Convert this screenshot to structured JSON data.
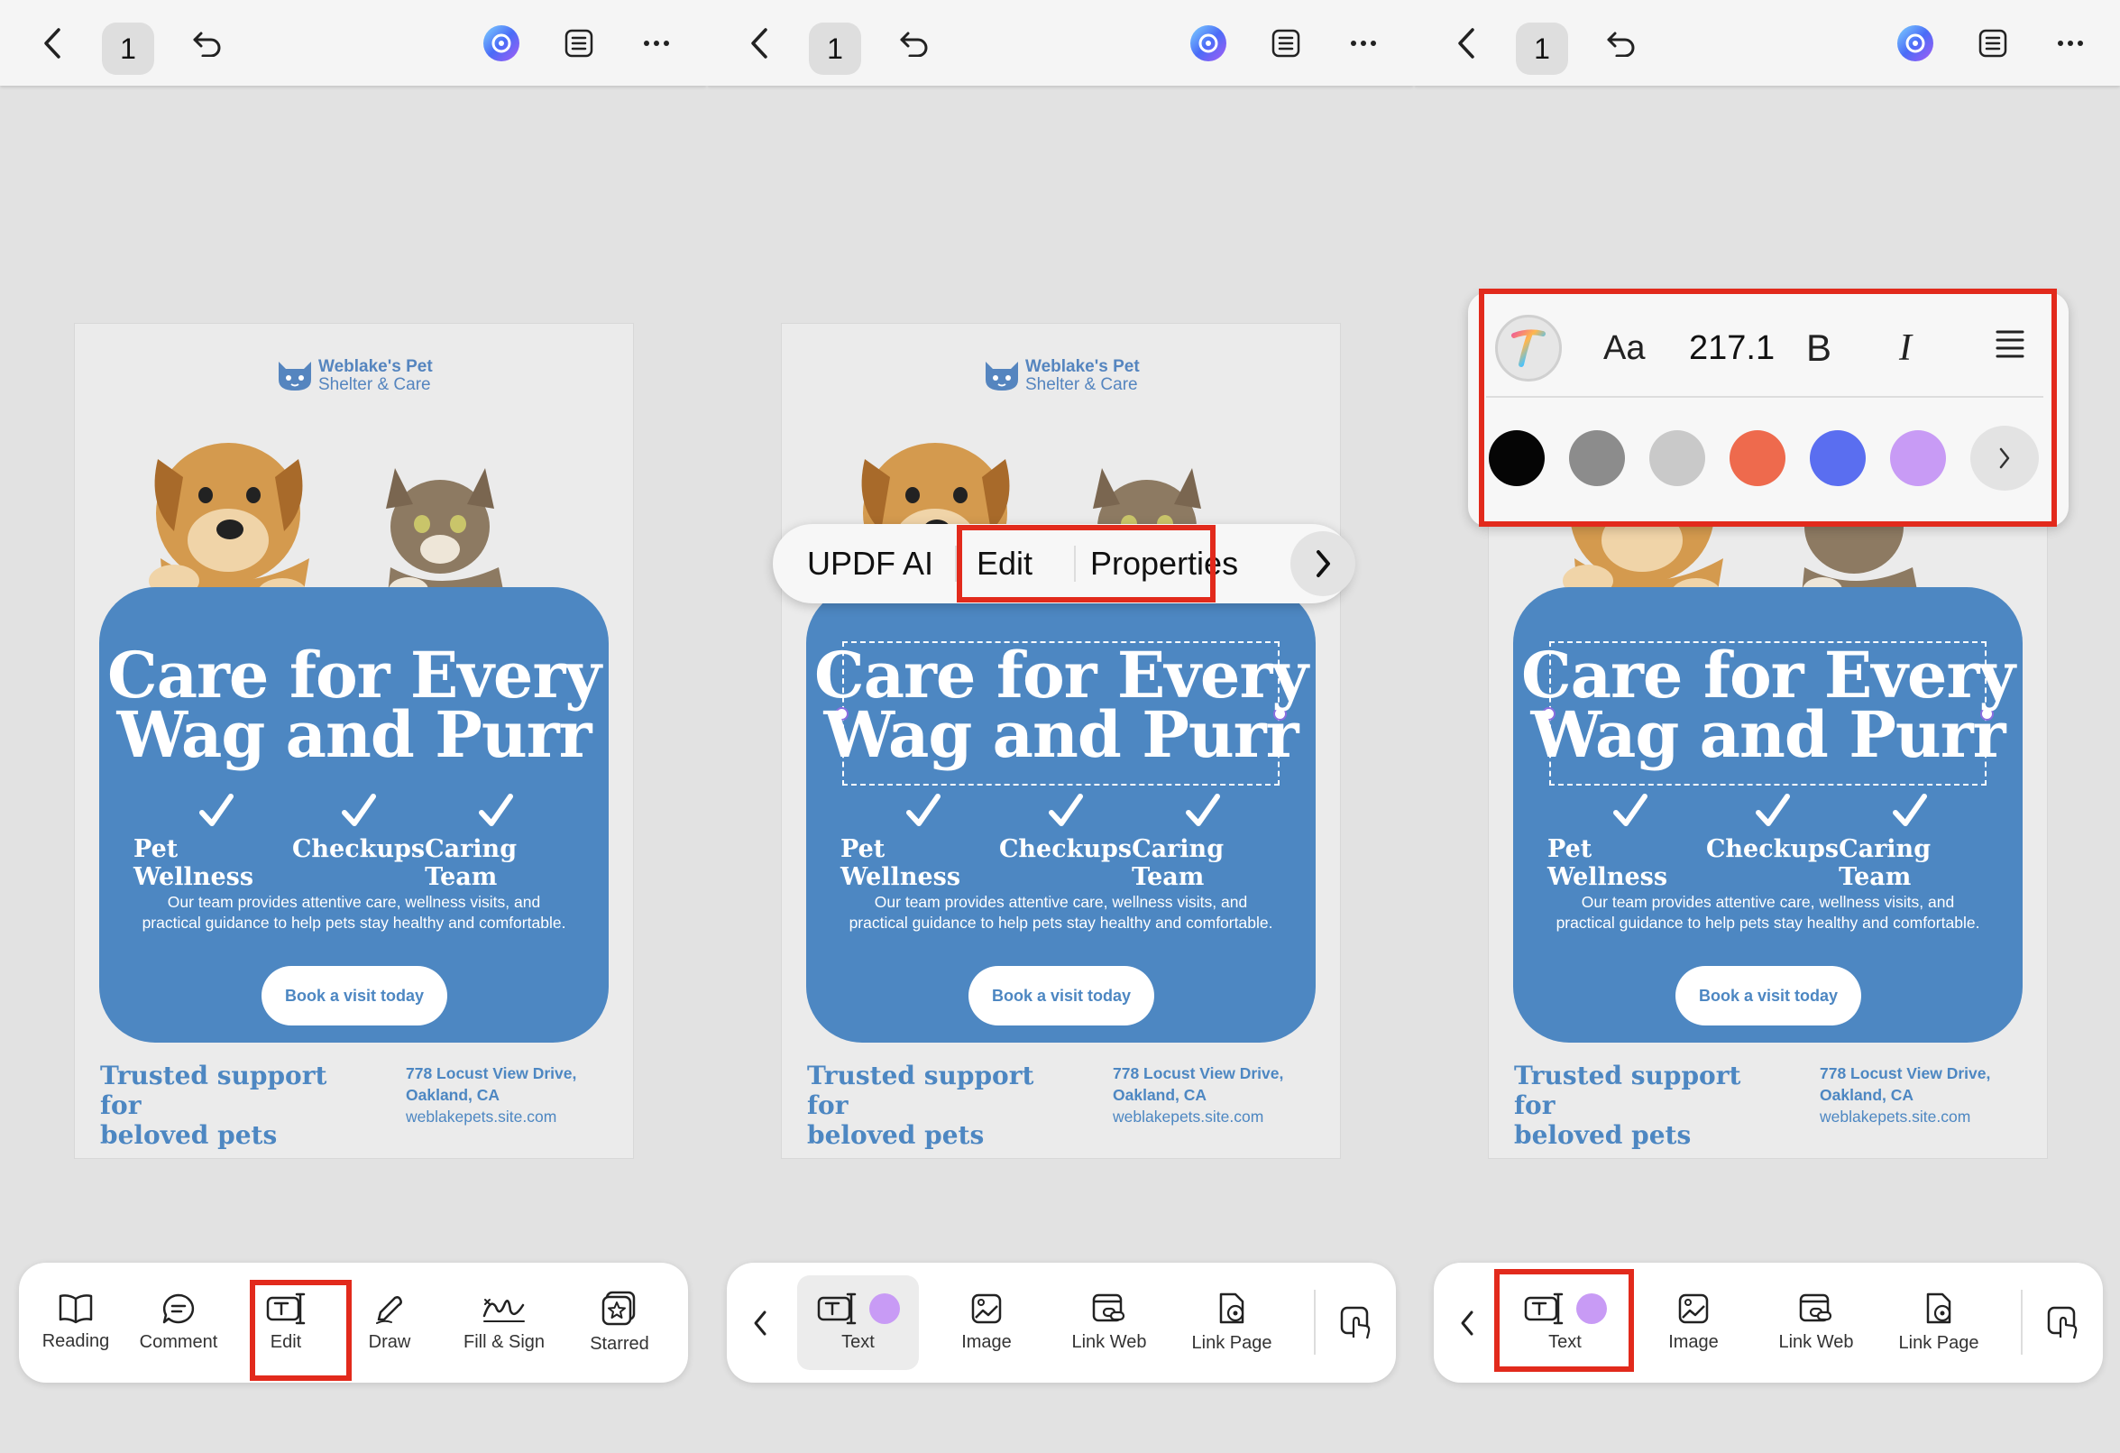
{
  "topbar": {
    "page_number": "1"
  },
  "flyer": {
    "logo_line1": "Weblake's Pet",
    "logo_line2": "Shelter & Care",
    "headline_line1": "Care for Every",
    "headline_line2": "Wag and Purr",
    "features": [
      "Pet Wellness",
      "Checkups",
      "Caring Team"
    ],
    "description_line1": "Our team provides attentive care, wellness visits, and",
    "description_line2": "practical guidance to help pets stay healthy and comfortable.",
    "button": "Book a visit today",
    "tagline_line1": "Trusted support for",
    "tagline_line2": "beloved pets",
    "address_line1": "778 Locust View Drive,",
    "address_line2": "Oakland, CA",
    "website": "weblakepets.site.com"
  },
  "bottombar_main": {
    "items": [
      {
        "label": "Reading",
        "icon": "book-icon"
      },
      {
        "label": "Comment",
        "icon": "comment-icon"
      },
      {
        "label": "Edit",
        "icon": "edit-text-icon"
      },
      {
        "label": "Draw",
        "icon": "pen-icon"
      },
      {
        "label": "Fill & Sign",
        "icon": "signature-icon"
      },
      {
        "label": "Starred",
        "icon": "star-icon"
      }
    ]
  },
  "bottombar_edit": {
    "items": [
      {
        "label": "Text",
        "icon": "edit-text-icon"
      },
      {
        "label": "Image",
        "icon": "image-icon"
      },
      {
        "label": "Link Web",
        "icon": "link-web-icon"
      },
      {
        "label": "Link Page",
        "icon": "link-page-icon"
      }
    ],
    "text_color": "#c89bf5"
  },
  "context_menu": {
    "items": [
      "UPDF AI",
      "Edit",
      "Properties"
    ]
  },
  "properties": {
    "font_label": "Aa",
    "font_size": "217.1",
    "bold": "B",
    "italic": "I",
    "colors": [
      "#050505",
      "#8c8c8c",
      "#c9c9c9",
      "#ee6a4d",
      "#5a6ef0",
      "#c89bf5"
    ]
  },
  "colors": {
    "accent": "#4d87c2",
    "highlight": "#e22a1c"
  }
}
